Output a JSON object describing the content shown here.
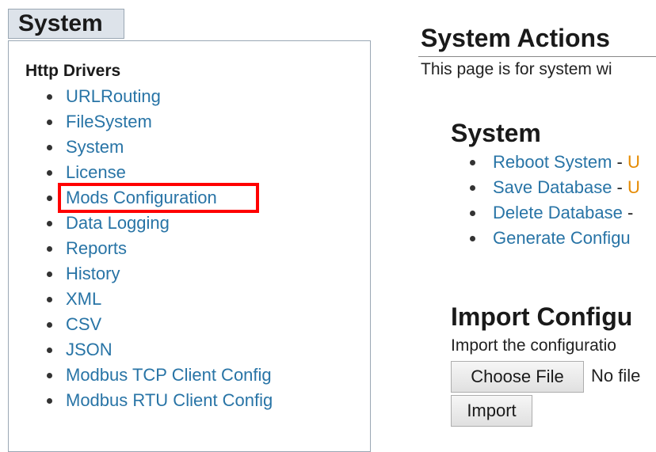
{
  "sidebar": {
    "tab_label": "System",
    "group_title": "Http Drivers",
    "items": [
      {
        "label": "URLRouting"
      },
      {
        "label": "FileSystem"
      },
      {
        "label": "System"
      },
      {
        "label": "License"
      },
      {
        "label": "Mods Configuration",
        "highlighted": true
      },
      {
        "label": "Data Logging"
      },
      {
        "label": "Reports"
      },
      {
        "label": "History"
      },
      {
        "label": "XML"
      },
      {
        "label": "CSV"
      },
      {
        "label": "JSON"
      },
      {
        "label": "Modbus TCP Client Config"
      },
      {
        "label": "Modbus RTU Client Config"
      }
    ],
    "highlight_color": "#ff0000",
    "link_color": "#2874a6"
  },
  "main": {
    "title": "System Actions",
    "description": "This page is for system wi",
    "system_section": {
      "title": "System",
      "actions": [
        {
          "label": "Reboot System",
          "sep": " - ",
          "tail": "U"
        },
        {
          "label": "Save Database",
          "sep": " - ",
          "tail": "U"
        },
        {
          "label": "Delete Database",
          "sep": " -",
          "tail": ""
        },
        {
          "label": "Generate Configu",
          "sep": "",
          "tail": ""
        }
      ]
    },
    "import_section": {
      "title": "Import Configu",
      "description": "Import the configuratio",
      "choose_file_label": "Choose File",
      "file_status": "No file",
      "import_label": "Import"
    }
  }
}
